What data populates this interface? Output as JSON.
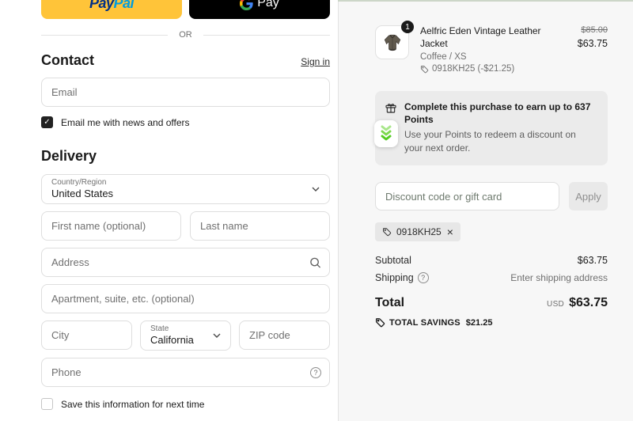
{
  "express": {
    "paypal_pay": "Pay",
    "paypal_pal": "Pal",
    "gpay_label": "Pay",
    "divider": "OR"
  },
  "contact": {
    "heading": "Contact",
    "signin_label": "Sign in",
    "email_placeholder": "Email",
    "newsletter_label": "Email me with news and offers"
  },
  "delivery": {
    "heading": "Delivery",
    "country_label": "Country/Region",
    "country_value": "United States",
    "first_name_placeholder": "First name (optional)",
    "last_name_placeholder": "Last name",
    "address_placeholder": "Address",
    "apartment_placeholder": "Apartment, suite, etc. (optional)",
    "city_placeholder": "City",
    "state_label": "State",
    "state_value": "California",
    "zip_placeholder": "ZIP code",
    "phone_placeholder": "Phone",
    "save_info_label": "Save this information for next time"
  },
  "order": {
    "item": {
      "qty": "1",
      "name": "Aelfric Eden Vintage Leather Jacket",
      "variant": "Coffee / XS",
      "discount_line": "0918KH25 (-$21.25)",
      "price_original": "$85.00",
      "price_current": "$63.75"
    },
    "points_banner": {
      "title": "Complete this purchase to earn up to 637 Points",
      "body": "Use your Points to redeem a discount on your next order."
    },
    "discount": {
      "placeholder": "Discount code or gift card",
      "apply_label": "Apply",
      "applied_code": "0918KH25",
      "remove_label": "×"
    },
    "summary": {
      "subtotal_label": "Subtotal",
      "subtotal_value": "$63.75",
      "shipping_label": "Shipping",
      "shipping_value": "Enter shipping address",
      "total_label": "Total",
      "currency": "USD",
      "total_value": "$63.75",
      "savings_label": "TOTAL SAVINGS",
      "savings_value": "$21.25"
    }
  },
  "colors": {
    "accent_top": "#ccd6c8",
    "paypal_yellow": "#ffc439",
    "gpay_black": "#000000",
    "rewards_green": "#55cc22",
    "panel_bg": "#f7f7f7"
  }
}
